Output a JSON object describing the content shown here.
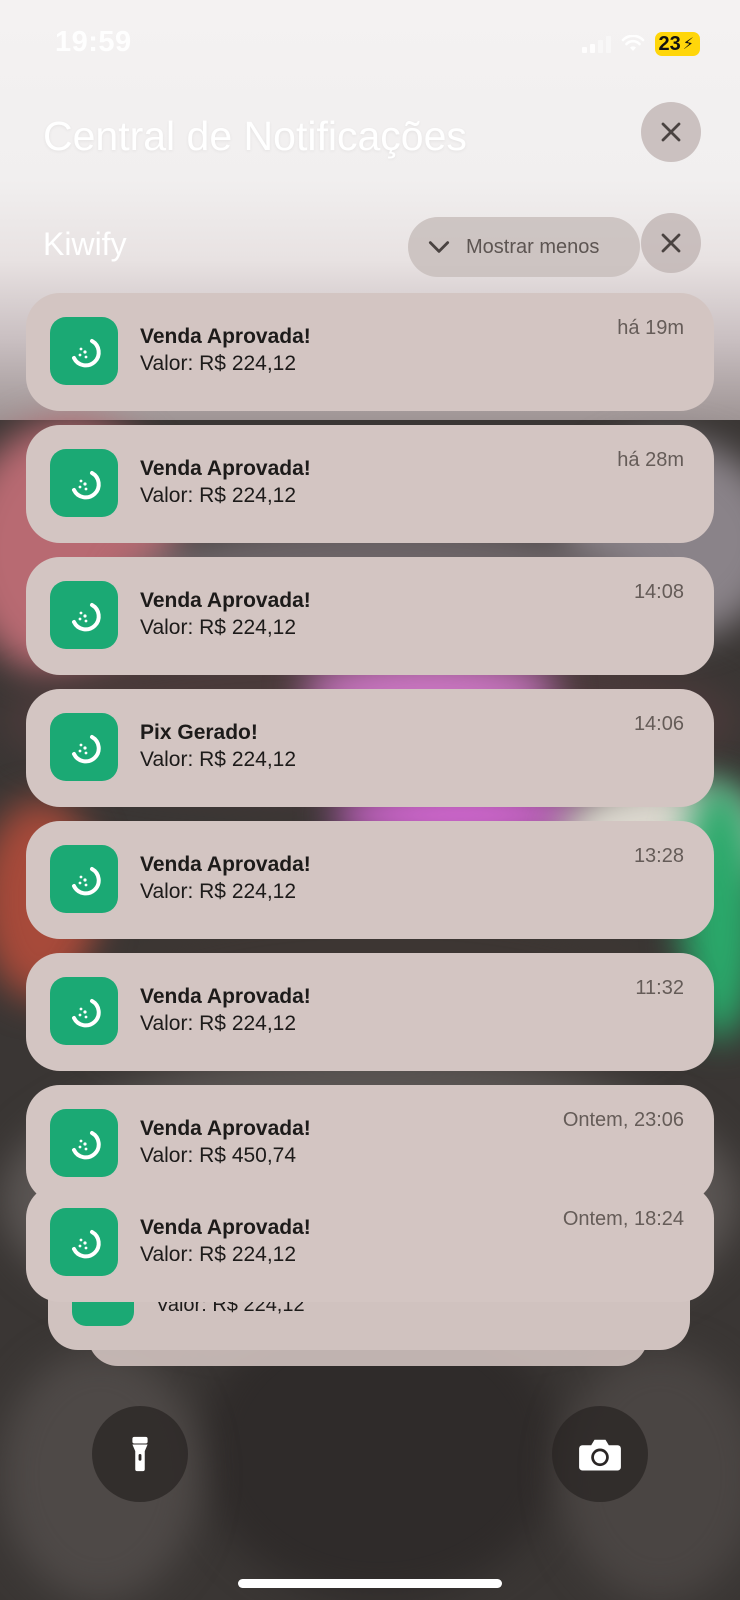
{
  "status_bar": {
    "time": "19:59",
    "battery_level": "23",
    "battery_color": "#ffd60a"
  },
  "header": {
    "title": "Central de Notificações"
  },
  "group": {
    "app_name": "Kiwify",
    "show_less_label": "Mostrar menos",
    "app_icon_color": "#1ba974"
  },
  "notifications": [
    {
      "title": "Venda Aprovada!",
      "body": "Valor: R$ 224,12",
      "time": "há 19m"
    },
    {
      "title": "Venda Aprovada!",
      "body": "Valor: R$ 224,12",
      "time": "há 28m"
    },
    {
      "title": "Venda Aprovada!",
      "body": "Valor: R$ 224,12",
      "time": "14:08"
    },
    {
      "title": "Pix Gerado!",
      "body": "Valor: R$ 224,12",
      "time": "14:06"
    },
    {
      "title": "Venda Aprovada!",
      "body": "Valor: R$ 224,12",
      "time": "13:28"
    },
    {
      "title": "Venda Aprovada!",
      "body": "Valor: R$ 224,12",
      "time": "11:32"
    },
    {
      "title": "Venda Aprovada!",
      "body": "Valor: R$ 450,74",
      "time": "Ontem, 23:06"
    },
    {
      "title": "Venda Aprovada!",
      "body": "Valor: R$ 224,12",
      "time": "Ontem, 18:24"
    }
  ],
  "stacked_preview": {
    "body": "Valor: R$ 224,12"
  },
  "icons": {
    "close": "close-icon",
    "chevron": "chevron-down-icon",
    "app": "kiwify-icon",
    "flashlight": "flashlight-icon",
    "camera": "camera-icon"
  }
}
